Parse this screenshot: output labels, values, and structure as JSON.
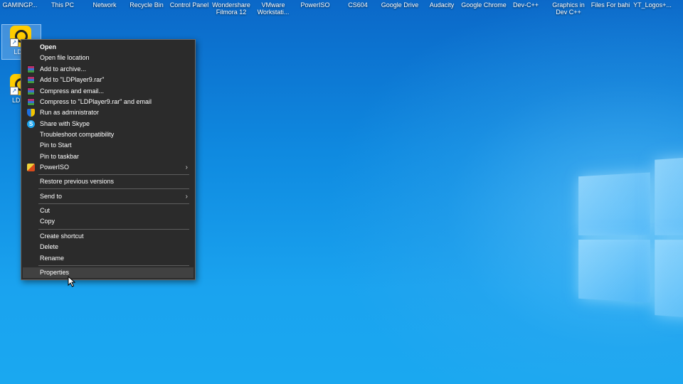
{
  "desktop": {
    "top_icons": [
      {
        "label": "GAMINGP..."
      },
      {
        "label": "This PC"
      },
      {
        "label": "Network"
      },
      {
        "label": "Recycle Bin"
      },
      {
        "label": "Control Panel"
      },
      {
        "label": "Wondershare Filmora 12"
      },
      {
        "label": "VMware Workstati..."
      },
      {
        "label": "PowerISO"
      },
      {
        "label": "CS604"
      },
      {
        "label": "Google Drive"
      },
      {
        "label": "Audacity"
      },
      {
        "label": "Google Chrome"
      },
      {
        "label": "Dev-C++"
      },
      {
        "label": "Graphics in Dev C++"
      },
      {
        "label": "Files For bahi"
      },
      {
        "label": "YT_Logos+..."
      }
    ],
    "left_icons": [
      {
        "label": "LDPl",
        "icon": "ldplayer-icon"
      },
      {
        "label": "LDMu",
        "icon": "ldmultiplayer-icon"
      }
    ]
  },
  "context_menu": {
    "items": [
      {
        "label": "Open",
        "bold": true,
        "icon": ""
      },
      {
        "label": "Open file location",
        "icon": ""
      },
      {
        "label": "Add to archive...",
        "icon": "winrar-icon"
      },
      {
        "label": "Add to \"LDPlayer9.rar\"",
        "icon": "winrar-icon"
      },
      {
        "label": "Compress and email...",
        "icon": "winrar-icon"
      },
      {
        "label": "Compress to \"LDPlayer9.rar\" and email",
        "icon": "winrar-icon"
      },
      {
        "label": "Run as administrator",
        "icon": "uac-shield-icon"
      },
      {
        "label": "Share with Skype",
        "icon": "skype-icon"
      },
      {
        "label": "Troubleshoot compatibility",
        "icon": ""
      },
      {
        "label": "Pin to Start",
        "icon": ""
      },
      {
        "label": "Pin to taskbar",
        "icon": ""
      },
      {
        "label": "PowerISO",
        "icon": "poweriso-icon",
        "submenu": true
      },
      {
        "label": "Restore previous versions",
        "icon": ""
      },
      {
        "label": "Send to",
        "icon": "",
        "submenu": true
      },
      {
        "label": "Cut",
        "icon": ""
      },
      {
        "label": "Copy",
        "icon": ""
      },
      {
        "label": "Create shortcut",
        "icon": ""
      },
      {
        "label": "Delete",
        "icon": ""
      },
      {
        "label": "Rename",
        "icon": ""
      },
      {
        "label": "Properties",
        "icon": "",
        "hovered": true
      }
    ],
    "submenu_glyph": "›",
    "skype_glyph": "S"
  },
  "colors": {
    "menu_bg": "#2b2b2b",
    "menu_hover": "#414141",
    "menu_text": "#ffffff",
    "desktop_top": "#0b68c8",
    "desktop_bottom": "#1aa8f0"
  }
}
